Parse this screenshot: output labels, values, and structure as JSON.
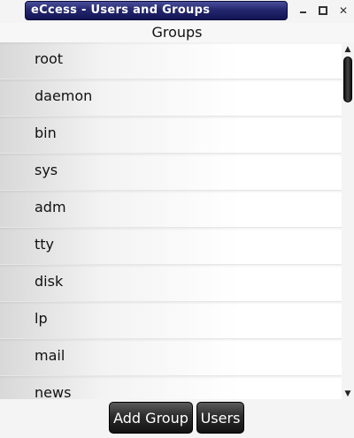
{
  "window": {
    "title": "eCcess - Users and Groups",
    "controls": {
      "minimize": "minimize-icon",
      "maximize": "maximize-icon",
      "close": "close-icon"
    },
    "title_color": "#25286f"
  },
  "header": {
    "title": "Groups"
  },
  "groups": {
    "items": [
      {
        "label": "root"
      },
      {
        "label": "daemon"
      },
      {
        "label": "bin"
      },
      {
        "label": "sys"
      },
      {
        "label": "adm"
      },
      {
        "label": "tty"
      },
      {
        "label": "disk"
      },
      {
        "label": "lp"
      },
      {
        "label": "mail"
      },
      {
        "label": "news"
      }
    ]
  },
  "scrollbar": {
    "up_icon": "scroll-up-arrow-icon",
    "down_icon": "scroll-down-arrow-icon"
  },
  "footer": {
    "add_group_label": "Add Group",
    "users_label": "Users"
  }
}
